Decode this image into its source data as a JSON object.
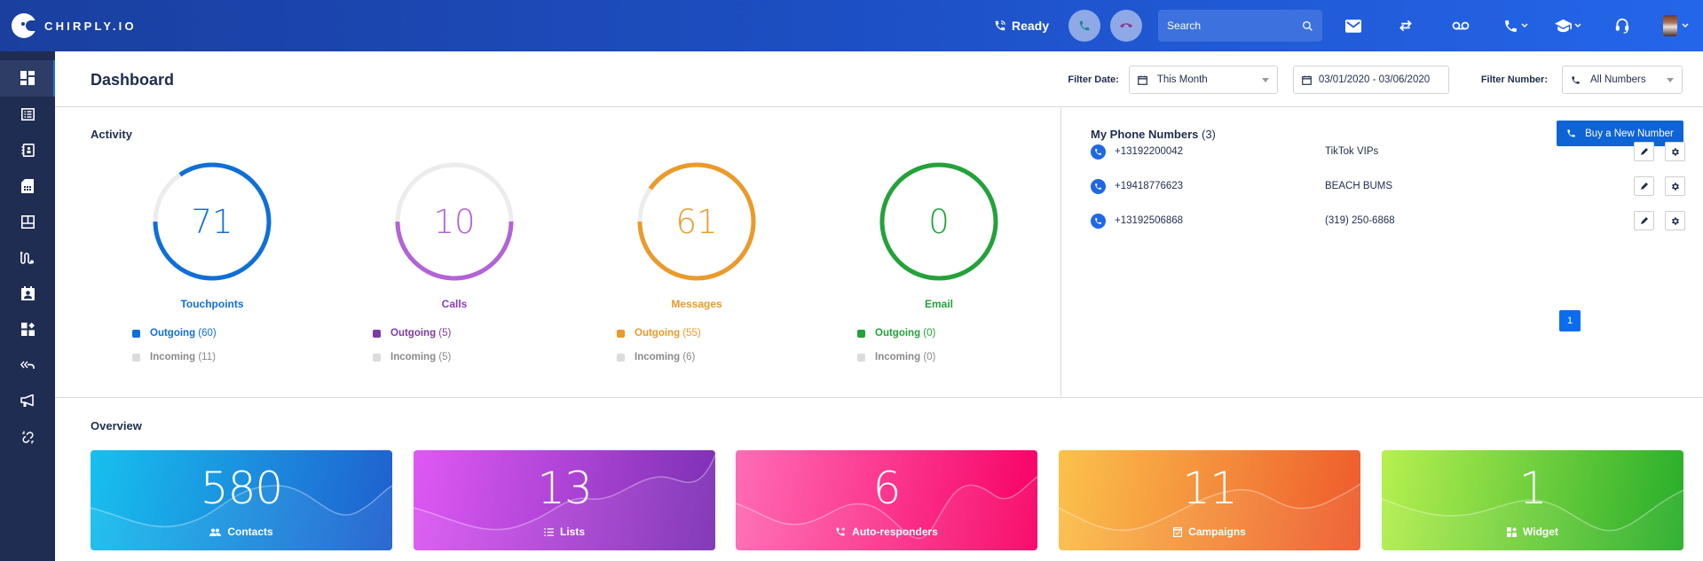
{
  "app": {
    "brand": "CHIRPLY.IO"
  },
  "topbar": {
    "status": "Ready",
    "search_placeholder": "Search",
    "icons": [
      "phone-ringing-icon",
      "answer-call-icon",
      "hangup-call-icon",
      "search-icon",
      "mail-icon",
      "transfer-icon",
      "voicemail-icon",
      "phone-icon",
      "graduation-cap-icon",
      "headset-icon",
      "user-avatar"
    ]
  },
  "sidebar": {
    "items": [
      {
        "name": "dashboard",
        "icon": "dashboard-icon",
        "active": true
      },
      {
        "name": "lists",
        "icon": "list-icon",
        "active": false
      },
      {
        "name": "contacts",
        "icon": "address-book-icon",
        "active": false
      },
      {
        "name": "numbers",
        "icon": "sim-card-icon",
        "active": false
      },
      {
        "name": "layouts",
        "icon": "layout-icon",
        "active": false
      },
      {
        "name": "flows",
        "icon": "route-icon",
        "active": false
      },
      {
        "name": "users",
        "icon": "contact-card-icon",
        "active": false
      },
      {
        "name": "widgets",
        "icon": "widgets-icon",
        "active": false
      },
      {
        "name": "auto-responders",
        "icon": "reply-all-icon",
        "active": false
      },
      {
        "name": "campaigns",
        "icon": "megaphone-icon",
        "active": false
      },
      {
        "name": "integrations",
        "icon": "unlink-icon",
        "active": false
      }
    ]
  },
  "header": {
    "title": "Dashboard",
    "filter_date_label": "Filter Date:",
    "filter_date_value": "This Month",
    "date_range": "03/01/2020 - 03/06/2020",
    "filter_number_label": "Filter Number:",
    "filter_number_value": "All Numbers"
  },
  "activity": {
    "title": "Activity",
    "metrics": [
      {
        "label": "Touchpoints",
        "total": "71",
        "outgoing": 60,
        "incoming": 11,
        "outgoing_text": "Outgoing",
        "incoming_text": "Incoming",
        "outgoing_count": "(60)",
        "incoming_count": "(11)",
        "color": "#0f6fd8",
        "fraction": 0.845
      },
      {
        "label": "Calls",
        "total": "10",
        "outgoing": 5,
        "incoming": 5,
        "outgoing_text": "Outgoing",
        "incoming_text": "Incoming",
        "outgoing_count": "(5)",
        "incoming_count": "(5)",
        "color": "#b263d6",
        "legend_color": "#7e3aa3",
        "fraction": 0.5
      },
      {
        "label": "Messages",
        "total": "61",
        "outgoing": 55,
        "incoming": 6,
        "outgoing_text": "Outgoing",
        "incoming_text": "Incoming",
        "outgoing_count": "(55)",
        "incoming_count": "(6)",
        "color": "#eb9a2a",
        "fraction": 0.9016
      },
      {
        "label": "Email",
        "total": "0",
        "outgoing": 0,
        "incoming": 0,
        "outgoing_text": "Outgoing",
        "incoming_text": "Incoming",
        "outgoing_count": "(0)",
        "incoming_count": "(0)",
        "color": "#23a23a",
        "fraction": 1.0
      }
    ]
  },
  "phones": {
    "title": "My Phone Numbers",
    "count": "(3)",
    "buy_label": "Buy a New Number",
    "rows": [
      {
        "number": "+13192200042",
        "name": "TikTok VIPs"
      },
      {
        "number": "+19418776623",
        "name": "BEACH BUMS"
      },
      {
        "number": "+13192506868",
        "name": "(319) 250-6868"
      }
    ],
    "page": "1"
  },
  "overview": {
    "title": "Overview",
    "cards": [
      {
        "value": "580",
        "label": "Contacts",
        "icon": "users-icon",
        "from": "#17c0ee",
        "to": "#1f5fcf"
      },
      {
        "value": "13",
        "label": "Lists",
        "icon": "list-icon",
        "from": "#df58f5",
        "to": "#7b2fb4"
      },
      {
        "value": "6",
        "label": "Auto-responders",
        "icon": "phone-forward-icon",
        "from": "#ff6cb7",
        "to": "#f70064"
      },
      {
        "value": "11",
        "label": "Campaigns",
        "icon": "calendar-check-icon",
        "from": "#fbc24b",
        "to": "#ee5a2c"
      },
      {
        "value": "1",
        "label": "Widget",
        "icon": "widgets-icon",
        "from": "#b7f050",
        "to": "#27ad2a"
      }
    ]
  },
  "colors": {
    "topbar_start": "#1a3f9f",
    "topbar_end": "#2466ea",
    "sidebar_bg": "#1f2d52",
    "primary": "#0e64d4",
    "text": "#1f2d4d",
    "muted": "#8a8a8a"
  }
}
